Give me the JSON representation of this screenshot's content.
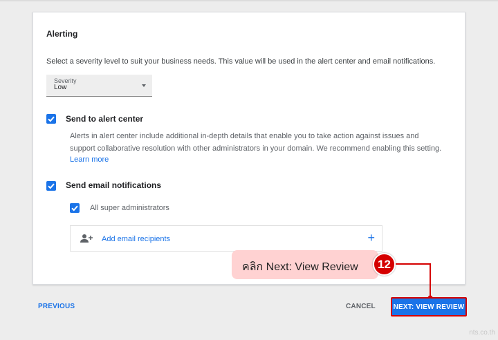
{
  "section": {
    "title": "Alerting",
    "description": "Select a severity level to suit your business needs. This value will be used in the alert center and email notifications."
  },
  "severity": {
    "label": "Severity",
    "value": "Low"
  },
  "alert_center": {
    "label": "Send to alert center",
    "checked": true,
    "description": "Alerts in alert center include additional in-depth details that enable you to take action against issues and support collaborative resolution with other administrators in your domain. We recommend enabling this setting.",
    "learn_more": "Learn more"
  },
  "email": {
    "label": "Send email notifications",
    "checked": true,
    "super_admins_label": "All super administrators",
    "super_admins_checked": true,
    "add_recipients_label": "Add email recipients",
    "add_icon": "+"
  },
  "callout": {
    "number": "12",
    "text": "คลิก Next: View Review"
  },
  "footer": {
    "previous": "PREVIOUS",
    "cancel": "CANCEL",
    "next": "NEXT: VIEW REVIEW"
  },
  "watermark": "nts.co.th",
  "colors": {
    "accent": "#1a73e8",
    "highlight": "#d50000",
    "callout_bg": "#ffd2d2"
  }
}
